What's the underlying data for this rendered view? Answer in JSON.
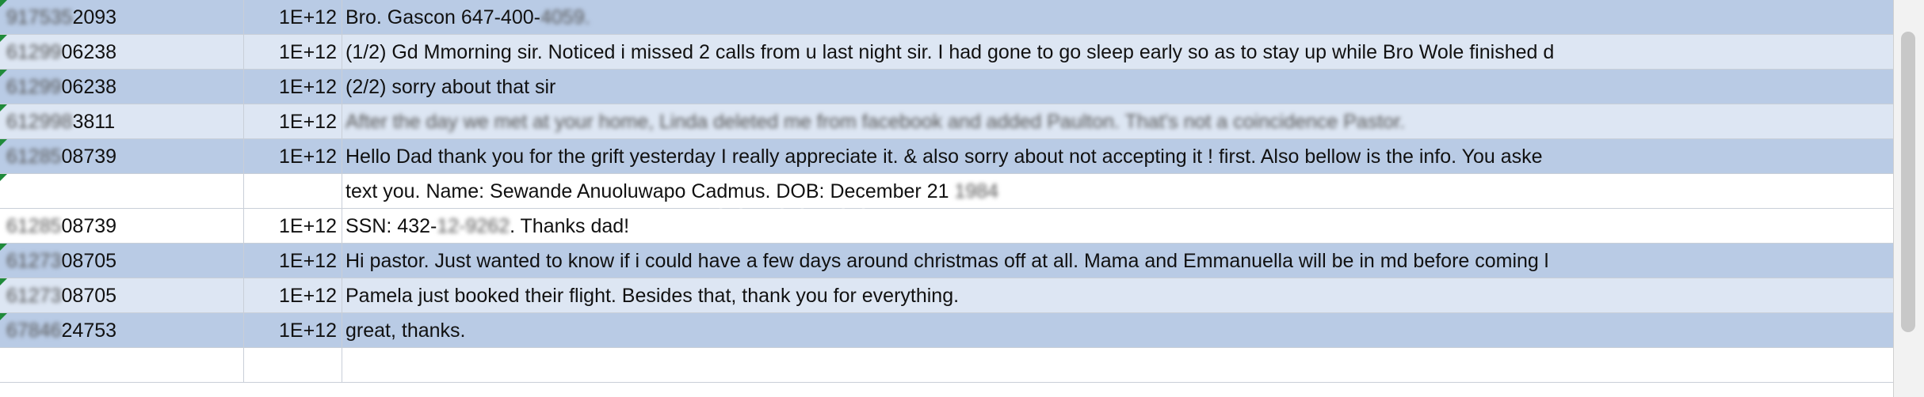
{
  "rows": [
    {
      "phone_hidden": "917535",
      "phone_visible": "2093",
      "num": "1E+12",
      "msg_pre": "Bro. Gascon 647-400-",
      "msg_hidden": "4059.",
      "msg_post": ""
    },
    {
      "phone_hidden": "61299",
      "phone_visible": "06238",
      "num": "1E+12",
      "msg_pre": "(1/2) Gd Mmorning sir. Noticed i missed 2 calls from u last night sir. I had gone to go sleep early so as to stay up while Bro Wole finished d",
      "msg_hidden": "",
      "msg_post": ""
    },
    {
      "phone_hidden": "61299",
      "phone_visible": "06238",
      "num": "1E+12",
      "msg_pre": "(2/2) sorry about that sir",
      "msg_hidden": "",
      "msg_post": ""
    },
    {
      "phone_hidden": "612998",
      "phone_visible": "3811",
      "num": "1E+12",
      "msg_pre": "",
      "msg_hidden": "After the day we met at your home, Linda deleted me from facebook and added Paulton. That's not a coincidence Pastor.",
      "msg_post": ""
    },
    {
      "phone_hidden": "61285",
      "phone_visible": "08739",
      "num": "1E+12",
      "msg_pre": "Hello Dad thank you for the grift yesterday I really appreciate it. & also sorry about not accepting it ! first. Also bellow is the info. You aske",
      "msg_hidden": "",
      "msg_post": ""
    },
    {
      "phone_hidden": "",
      "phone_visible": "",
      "num": "",
      "msg_pre": "text you. Name: Sewande Anuoluwapo Cadmus. DOB: December 21 ",
      "msg_hidden": "1984",
      "msg_post": ""
    },
    {
      "phone_hidden": "61285",
      "phone_visible": "08739",
      "num": "1E+12",
      "msg_pre": "SSN: 432-",
      "msg_hidden": "12-9262",
      "msg_post": ". Thanks dad!"
    },
    {
      "phone_hidden": "61273",
      "phone_visible": "08705",
      "num": "1E+12",
      "msg_pre": "Hi pastor. Just wanted to know if i could have a few days around christmas off at all. Mama and Emmanuella will be in md before coming l",
      "msg_hidden": "",
      "msg_post": ""
    },
    {
      "phone_hidden": "61273",
      "phone_visible": "08705",
      "num": "1E+12",
      "msg_pre": "Pamela just booked their flight. Besides that, thank you for everything.",
      "msg_hidden": "",
      "msg_post": ""
    },
    {
      "phone_hidden": "67846",
      "phone_visible": "24753",
      "num": "1E+12",
      "msg_pre": "great, thanks.",
      "msg_hidden": "",
      "msg_post": ""
    },
    {
      "phone_hidden": "",
      "phone_visible": "",
      "num": "",
      "msg_pre": "",
      "msg_hidden": "",
      "msg_post": ""
    }
  ],
  "colors": {
    "band": "#b9cbe5",
    "plain": "#dde6f3",
    "error_indicator": "#1f8a3a"
  },
  "icons": {
    "error_indicator": "green-triangle-icon"
  }
}
